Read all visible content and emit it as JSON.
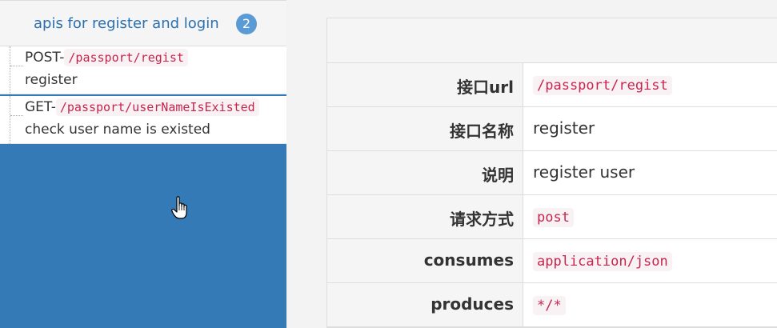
{
  "sidebar": {
    "group_title": "apis for register and login",
    "badge_count": "2",
    "items": [
      {
        "method": "POST-",
        "path": "/passport/regist",
        "description": "register"
      },
      {
        "method": "GET-",
        "path": "/passport/userNameIsExisted",
        "description": "check user name is existed"
      }
    ]
  },
  "detail": {
    "rows": [
      {
        "label": "接口url",
        "value": "/passport/regist",
        "is_code": true
      },
      {
        "label": "接口名称",
        "value": "register",
        "is_code": false
      },
      {
        "label": "说明",
        "value": "register user",
        "is_code": false
      },
      {
        "label": "请求方式",
        "value": "post",
        "is_code": true
      },
      {
        "label": "consumes",
        "value": "application/json",
        "is_code": true
      },
      {
        "label": "produces",
        "value": "*/*",
        "is_code": true
      }
    ]
  },
  "colors": {
    "sidebar_bg": "#337ab7",
    "code_text": "#c7254e",
    "code_bg": "#f9f2f4",
    "badge_bg": "#5b9bd5"
  },
  "icons": {
    "cursor": "hand-pointer-icon"
  }
}
